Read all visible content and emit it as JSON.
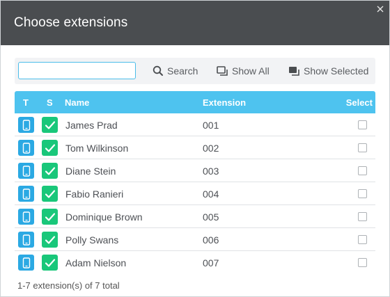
{
  "dialog": {
    "title": "Choose extensions",
    "close_icon": "close-icon"
  },
  "toolbar": {
    "search_value": "",
    "search_label": "Search",
    "show_all_label": "Show All",
    "show_selected_label": "Show Selected"
  },
  "table": {
    "columns": {
      "type": "T",
      "status": "S",
      "name": "Name",
      "extension": "Extension",
      "select": "Select"
    },
    "rows": [
      {
        "name": "James Prad",
        "extension": "001",
        "selected": false
      },
      {
        "name": "Tom Wilkinson",
        "extension": "002",
        "selected": false
      },
      {
        "name": "Diane Stein",
        "extension": "003",
        "selected": false
      },
      {
        "name": "Fabio Ranieri",
        "extension": "004",
        "selected": false
      },
      {
        "name": "Dominique Brown",
        "extension": "005",
        "selected": false
      },
      {
        "name": "Polly Swans",
        "extension": "006",
        "selected": false
      },
      {
        "name": "Adam Nielson",
        "extension": "007",
        "selected": false
      }
    ]
  },
  "footer": {
    "count_text": "1-7 extension(s) of 7 total"
  },
  "colors": {
    "header_bg": "#4a4d50",
    "table_header_bg": "#4ec3ef",
    "type_badge": "#2ba9e3",
    "status_badge": "#19c77a"
  }
}
